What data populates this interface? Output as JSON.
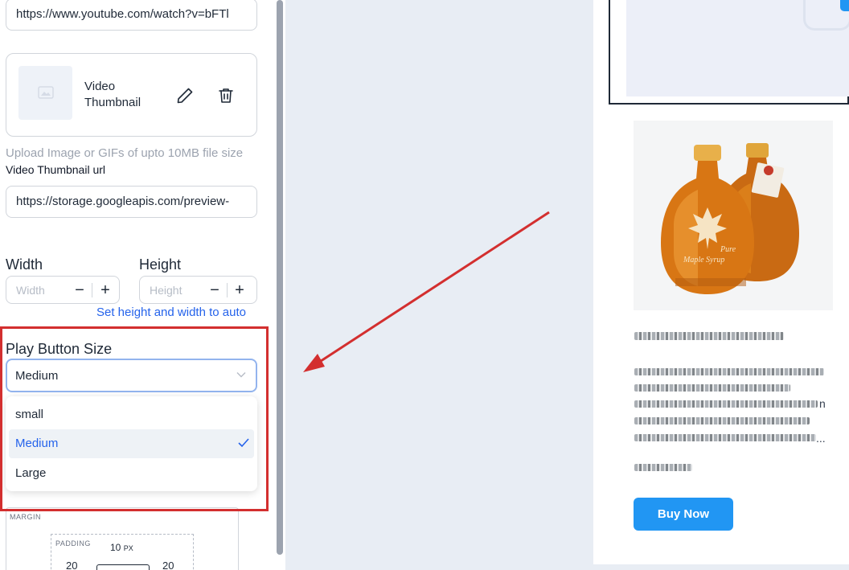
{
  "settings": {
    "video_url": "https://www.youtube.com/watch?v=bFTl",
    "thumbnail": {
      "label": "Video Thumbnail",
      "edit_icon": "pencil-icon",
      "delete_icon": "trash-icon"
    },
    "upload_hint": "Upload Image or GIFs of upto 10MB file size",
    "thumbnail_url_label": "Video Thumbnail url",
    "thumbnail_url_value": "https://storage.googleapis.com/preview-",
    "width": {
      "label": "Width",
      "placeholder": "Width",
      "minus": "−",
      "plus": "+"
    },
    "height": {
      "label": "Height",
      "placeholder": "Height",
      "minus": "−",
      "plus": "+"
    },
    "auto_link": "Set height and width to auto",
    "play_button_size": {
      "label": "Play Button Size",
      "selected": "Medium",
      "options": [
        "small",
        "Medium",
        "Large"
      ]
    },
    "spacing": {
      "margin_label": "MARGIN",
      "padding_label": "PADDING",
      "padding_top": "10",
      "padding_top_unit": "PX",
      "padding_left": "20",
      "padding_right": "20"
    }
  },
  "preview": {
    "more_text": "n",
    "ellipsis": "...",
    "buy_button": "Buy Now"
  },
  "colors": {
    "annotation": "#d32f2f",
    "accent": "#2196f3",
    "link": "#2563eb"
  }
}
